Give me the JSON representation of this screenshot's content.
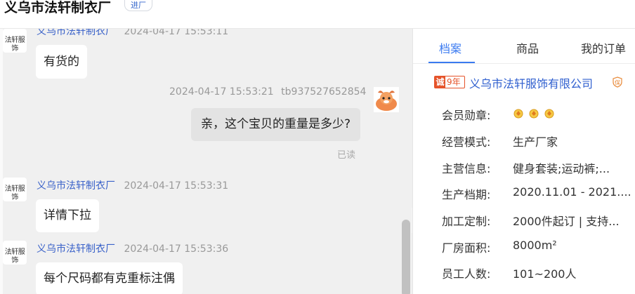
{
  "header": {
    "shop_title": "义乌市法轩制衣厂",
    "enter_label": "进厂"
  },
  "chat": {
    "messages": [
      {
        "sender": "义乌市法轩制衣厂",
        "time": "2024-04-17 15:53:11",
        "text": "有货的",
        "avatar_text": "法轩服饰"
      },
      {
        "sender": "tb937527652854",
        "time": "2024-04-17 15:53:21",
        "text": "亲，这个宝贝的重量是多少?",
        "status": "已读"
      },
      {
        "sender": "义乌市法轩制衣厂",
        "time": "2024-04-17 15:53:31",
        "text": "详情下拉",
        "avatar_text": "法轩服饰"
      },
      {
        "sender": "义乌市法轩制衣厂",
        "time": "2024-04-17 15:53:36",
        "text": "每个尺码都有克重标注偶",
        "avatar_text": "法轩服饰"
      }
    ],
    "collapse_glyph": "»"
  },
  "panel": {
    "tabs": [
      {
        "label": "档案",
        "active": true
      },
      {
        "label": "商品",
        "active": false
      },
      {
        "label": "我的订单",
        "active": false
      }
    ],
    "company": {
      "badge_char": "诚",
      "badge_years": "9年",
      "name": "义乌市法轩服饰有限公司",
      "badge_icon": "guarantee-icon"
    },
    "info": [
      {
        "key": "会员勋章:",
        "value": ""
      },
      {
        "key": "经营模式:",
        "value": "生产厂家"
      },
      {
        "key": "主营信息:",
        "value": "健身套装;运动裤;..."
      },
      {
        "key": "生产档期:",
        "value": "2020.11.01 - 2021...."
      },
      {
        "key": "加工定制:",
        "value": "2000件起订 | 支持..."
      },
      {
        "key": "厂房面积:",
        "value": "8000m²"
      },
      {
        "key": "员工人数:",
        "value": "101~200人"
      }
    ],
    "medal_count": 3
  },
  "colors": {
    "accent": "#3a7af0",
    "link": "#2f5fcf",
    "badge": "#e5532a",
    "chat_bg": "#f0f0f0"
  }
}
